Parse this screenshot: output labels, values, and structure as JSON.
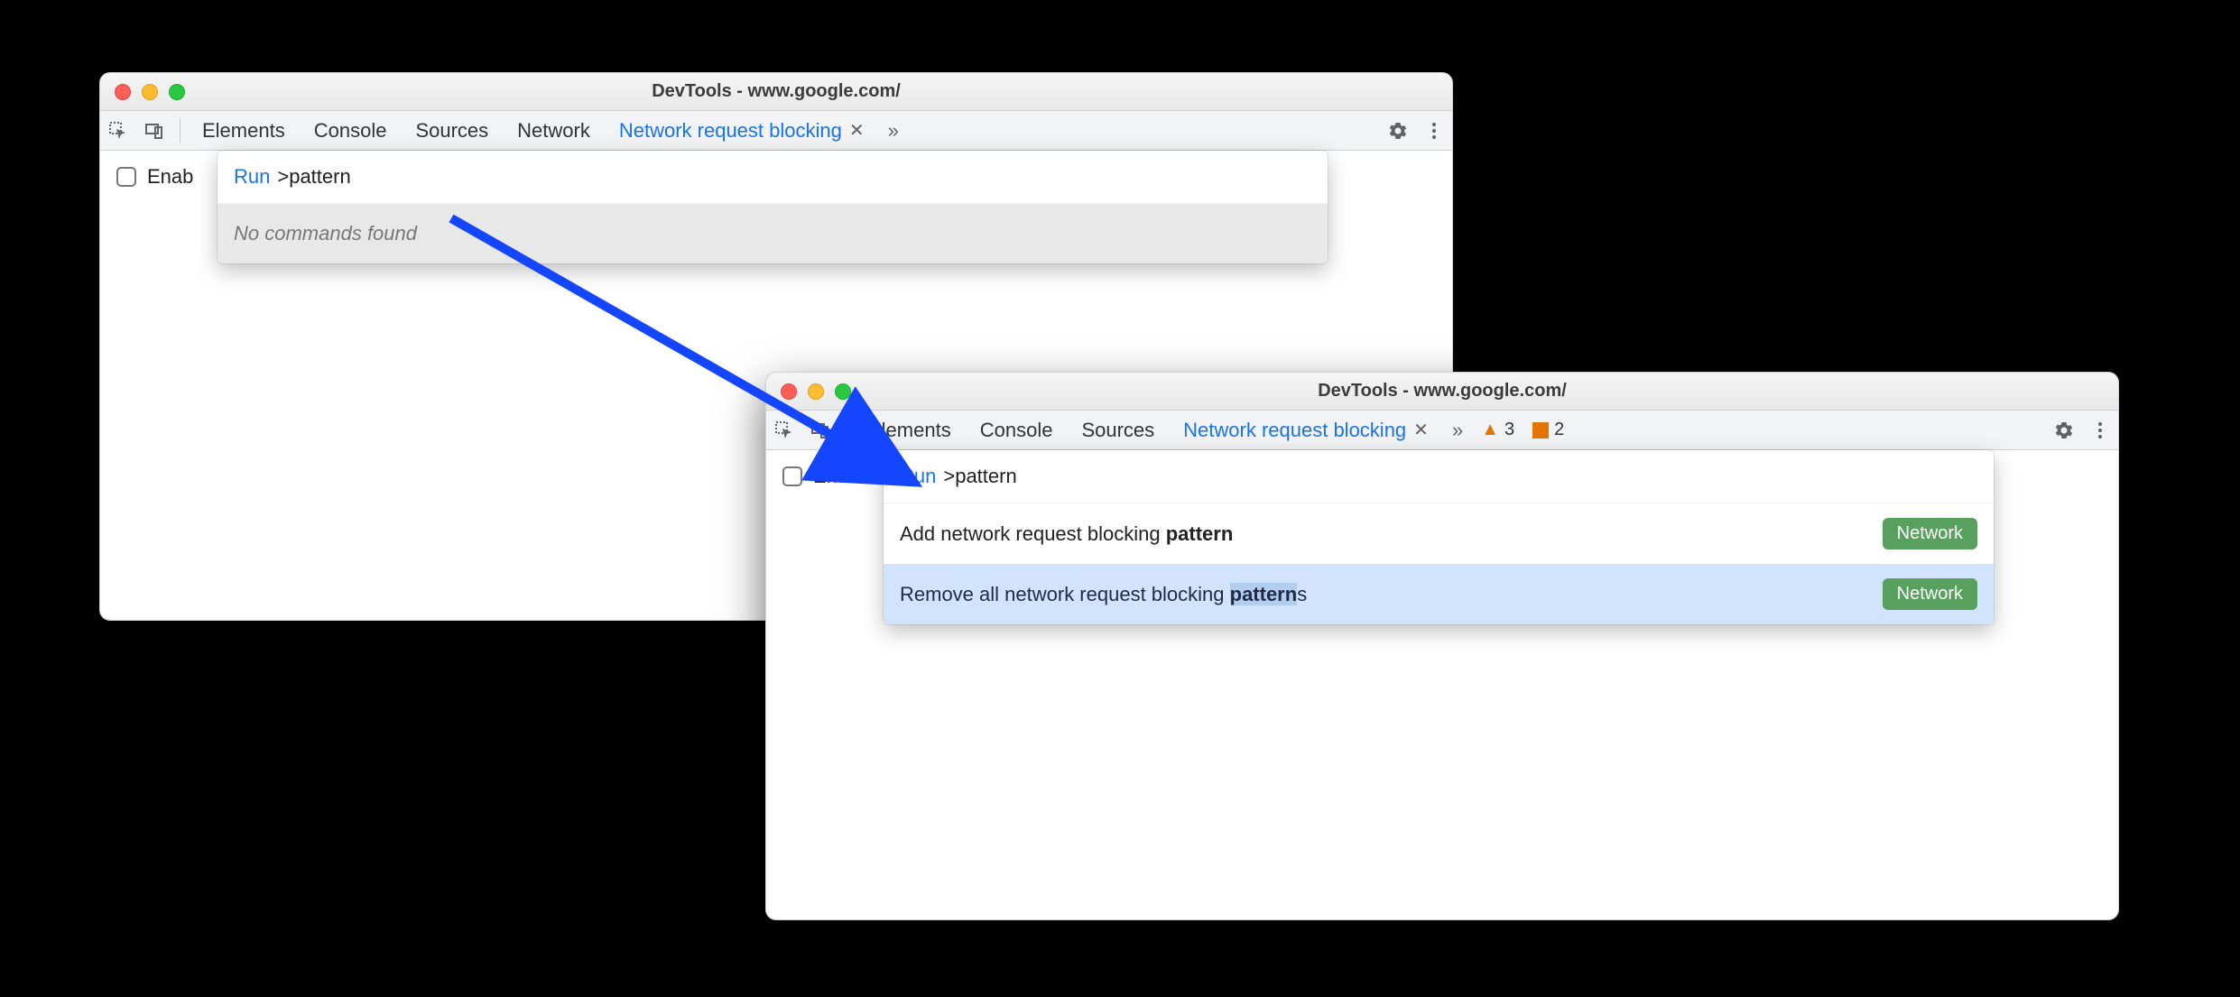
{
  "window1": {
    "title": "DevTools - www.google.com/",
    "tabs": [
      "Elements",
      "Console",
      "Sources",
      "Network",
      "Network request blocking"
    ],
    "active_tab_index": 4,
    "enable_label": "Enab",
    "command_menu": {
      "run_label": "Run",
      "query": ">pattern",
      "empty_message": "No commands found"
    }
  },
  "window2": {
    "title": "DevTools - www.google.com/",
    "tabs": [
      "Elements",
      "Console",
      "Sources",
      "Network request blocking"
    ],
    "active_tab_index": 3,
    "warn_count": "3",
    "issue_count": "2",
    "enable_label": "Enab",
    "command_menu": {
      "run_label": "Run",
      "query": ">pattern",
      "results": [
        {
          "prefix": "Add network request blocking ",
          "match": "pattern",
          "suffix": "",
          "category": "Network"
        },
        {
          "prefix": "Remove all network request blocking ",
          "match": "pattern",
          "suffix": "s",
          "category": "Network"
        }
      ],
      "highlight_index": 1
    }
  }
}
